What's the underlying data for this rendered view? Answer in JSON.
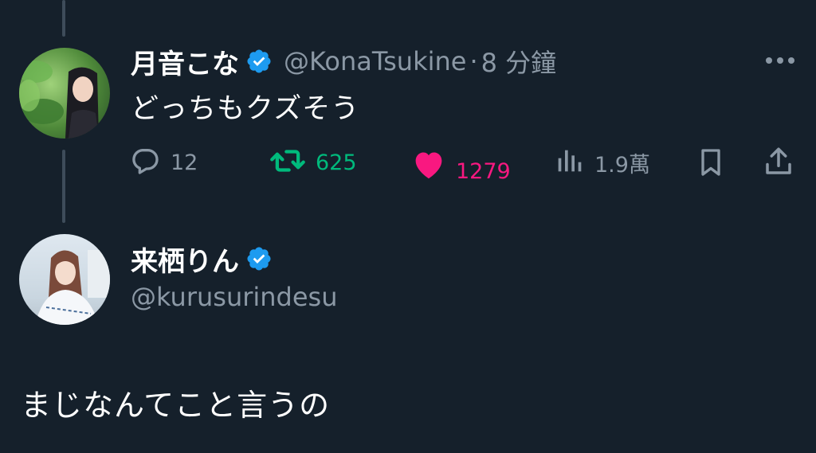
{
  "tweet1": {
    "display_name": "月音こな",
    "handle": "@KonaTsukine",
    "separator": "·",
    "time": "8 分鐘",
    "text": "どっちもクズそう",
    "actions": {
      "replies": "12",
      "retweets": "625",
      "likes": "1279",
      "views": "1.9萬"
    },
    "icons": {
      "reply": "reply-icon",
      "retweet": "retweet-icon",
      "like": "heart-icon",
      "views": "views-chart-icon",
      "bookmark": "bookmark-icon",
      "share": "share-icon",
      "more": "more-icon",
      "verified": "verified-badge-icon"
    },
    "colors": {
      "retweet": "#00ba7c",
      "like": "#f91880",
      "verified": "#1d9bf0"
    }
  },
  "tweet2": {
    "display_name": "来栖りん",
    "handle": "@kurusurindesu",
    "text": "まじなんてこと言うの",
    "icons": {
      "verified": "verified-badge-icon"
    }
  }
}
